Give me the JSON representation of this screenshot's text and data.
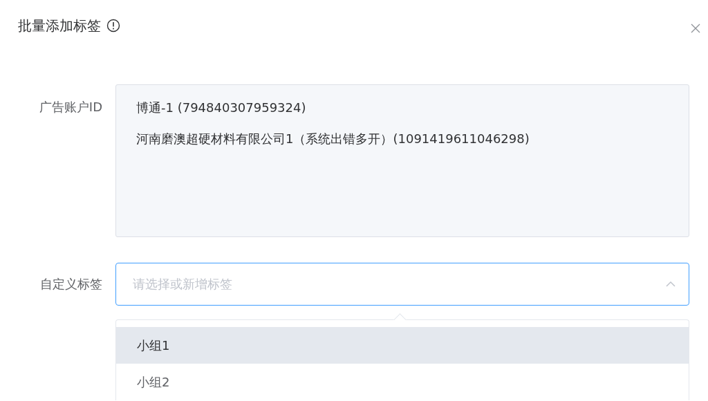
{
  "dialog": {
    "title": "批量添加标签",
    "fields": [
      {
        "kind": "readonly",
        "label": "广告账户ID",
        "lines": [
          "博通-1 (794840307959324)",
          "河南磨澳超硬材料有限公司1（系统出错多开）(1091419611046298)"
        ]
      },
      {
        "kind": "select",
        "label": "自定义标签",
        "placeholder": "请选择或新增标签",
        "expanded": true,
        "options": [
          {
            "label": "小组1",
            "hovered": true
          },
          {
            "label": "小组2",
            "hovered": false
          }
        ]
      }
    ]
  }
}
